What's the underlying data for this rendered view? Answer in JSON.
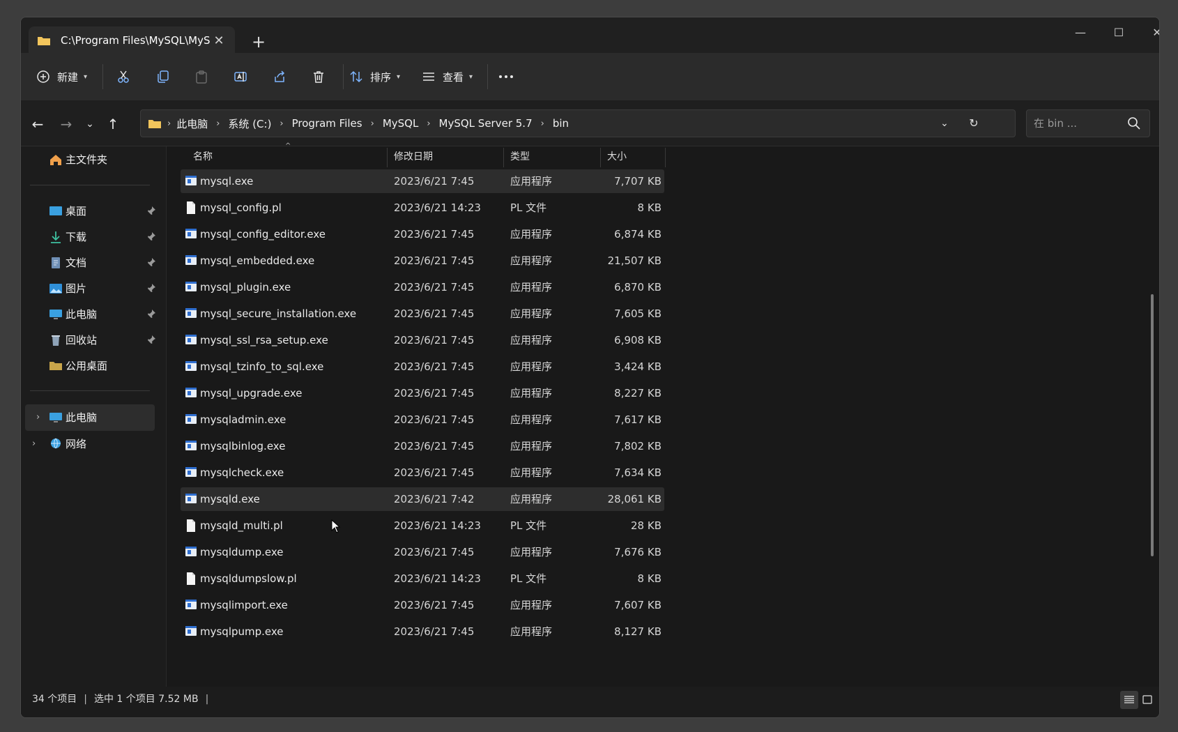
{
  "tab": {
    "title": "C:\\Program Files\\MySQL\\MyS",
    "new_tab": "+"
  },
  "toolbar": {
    "new_label": "新建",
    "sort_label": "排序",
    "view_label": "查看"
  },
  "breadcrumb": [
    "此电脑",
    "系统 (C:)",
    "Program Files",
    "MySQL",
    "MySQL Server 5.7",
    "bin"
  ],
  "search": {
    "placeholder": "在 bin ..."
  },
  "sidebar": {
    "home": "主文件夹",
    "pinned": [
      "桌面",
      "下载",
      "文档",
      "图片",
      "此电脑",
      "回收站"
    ],
    "other": [
      "公用桌面"
    ],
    "tree": [
      "此电脑",
      "网络"
    ]
  },
  "columns": {
    "name": "名称",
    "date": "修改日期",
    "type": "类型",
    "size": "大小"
  },
  "files": [
    {
      "name": "mysql.exe",
      "date": "2023/6/21 7:45",
      "type": "应用程序",
      "size": "7,707 KB",
      "icon": "exe-icon"
    },
    {
      "name": "mysql_config.pl",
      "date": "2023/6/21 14:23",
      "type": "PL 文件",
      "size": "8 KB",
      "icon": "file-icon"
    },
    {
      "name": "mysql_config_editor.exe",
      "date": "2023/6/21 7:45",
      "type": "应用程序",
      "size": "6,874 KB",
      "icon": "exe-icon"
    },
    {
      "name": "mysql_embedded.exe",
      "date": "2023/6/21 7:45",
      "type": "应用程序",
      "size": "21,507 KB",
      "icon": "exe-icon"
    },
    {
      "name": "mysql_plugin.exe",
      "date": "2023/6/21 7:45",
      "type": "应用程序",
      "size": "6,870 KB",
      "icon": "exe-icon"
    },
    {
      "name": "mysql_secure_installation.exe",
      "date": "2023/6/21 7:45",
      "type": "应用程序",
      "size": "7,605 KB",
      "icon": "exe-icon"
    },
    {
      "name": "mysql_ssl_rsa_setup.exe",
      "date": "2023/6/21 7:45",
      "type": "应用程序",
      "size": "6,908 KB",
      "icon": "exe-icon"
    },
    {
      "name": "mysql_tzinfo_to_sql.exe",
      "date": "2023/6/21 7:45",
      "type": "应用程序",
      "size": "3,424 KB",
      "icon": "exe-icon"
    },
    {
      "name": "mysql_upgrade.exe",
      "date": "2023/6/21 7:45",
      "type": "应用程序",
      "size": "8,227 KB",
      "icon": "exe-icon"
    },
    {
      "name": "mysqladmin.exe",
      "date": "2023/6/21 7:45",
      "type": "应用程序",
      "size": "7,617 KB",
      "icon": "exe-icon"
    },
    {
      "name": "mysqlbinlog.exe",
      "date": "2023/6/21 7:45",
      "type": "应用程序",
      "size": "7,802 KB",
      "icon": "exe-icon"
    },
    {
      "name": "mysqlcheck.exe",
      "date": "2023/6/21 7:45",
      "type": "应用程序",
      "size": "7,634 KB",
      "icon": "exe-icon"
    },
    {
      "name": "mysqld.exe",
      "date": "2023/6/21 7:42",
      "type": "应用程序",
      "size": "28,061 KB",
      "icon": "exe-icon"
    },
    {
      "name": "mysqld_multi.pl",
      "date": "2023/6/21 14:23",
      "type": "PL 文件",
      "size": "28 KB",
      "icon": "file-icon"
    },
    {
      "name": "mysqldump.exe",
      "date": "2023/6/21 7:45",
      "type": "应用程序",
      "size": "7,676 KB",
      "icon": "exe-icon"
    },
    {
      "name": "mysqldumpslow.pl",
      "date": "2023/6/21 14:23",
      "type": "PL 文件",
      "size": "8 KB",
      "icon": "file-icon"
    },
    {
      "name": "mysqlimport.exe",
      "date": "2023/6/21 7:45",
      "type": "应用程序",
      "size": "7,607 KB",
      "icon": "exe-icon"
    },
    {
      "name": "mysqlpump.exe",
      "date": "2023/6/21 7:45",
      "type": "应用程序",
      "size": "8,127 KB",
      "icon": "exe-icon"
    }
  ],
  "selected_rows": [
    "mysql.exe",
    "mysqld.exe"
  ],
  "status": {
    "count": "34 个项目",
    "selection": "选中 1 个项目  7.52 MB"
  },
  "colors": {
    "accent": "#4cc2ff",
    "folder": "#f2c55c",
    "background": "#191919"
  }
}
